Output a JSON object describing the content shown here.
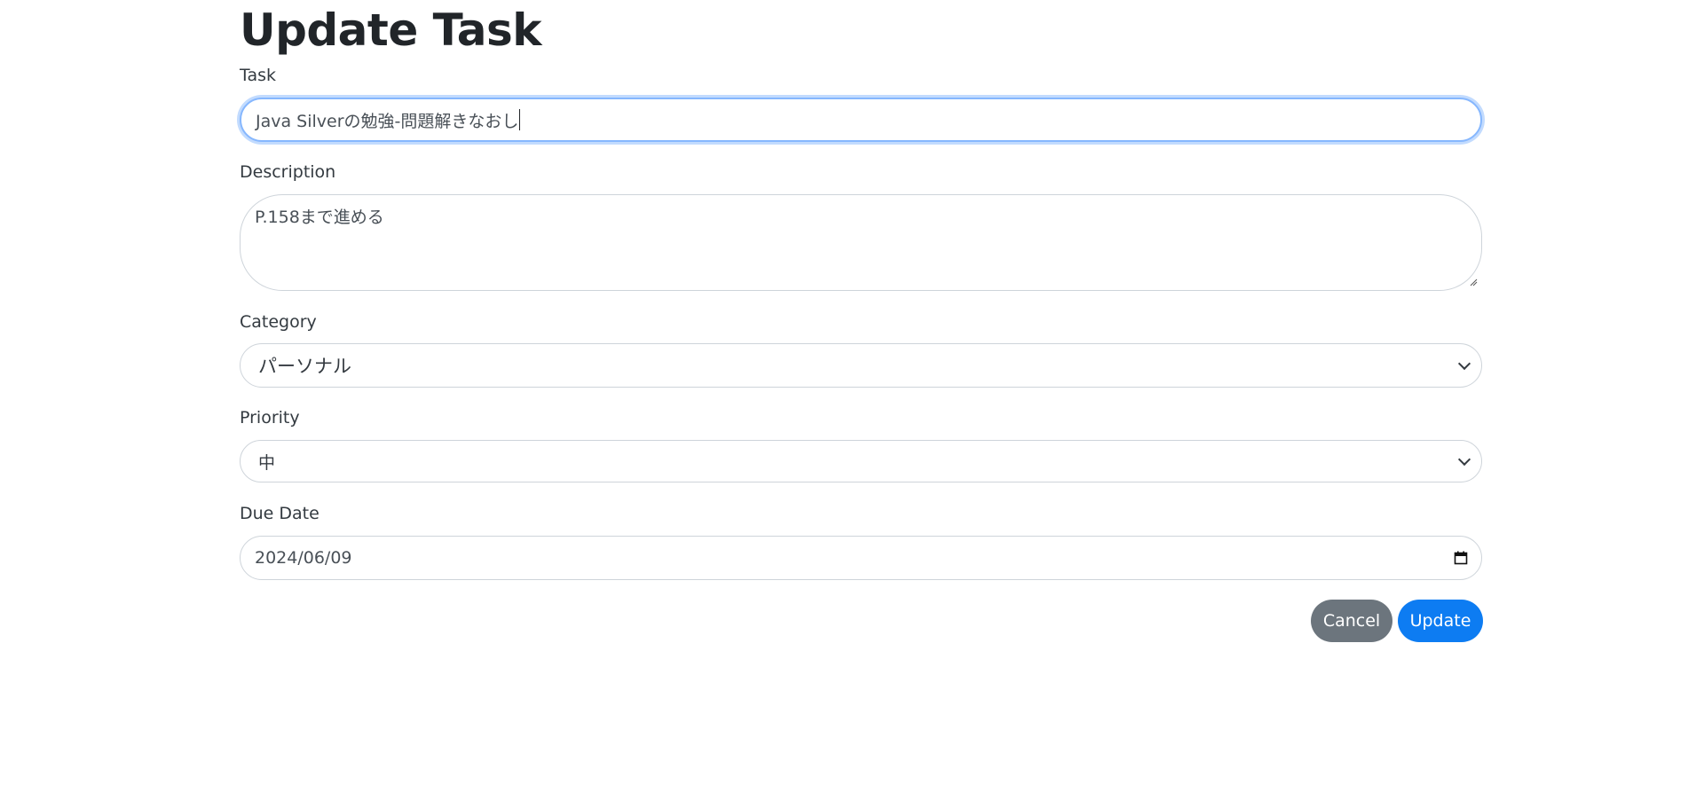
{
  "page": {
    "title": "Update Task"
  },
  "form": {
    "task": {
      "label": "Task",
      "value": "Java Silverの勉強-問題解きなおし"
    },
    "description": {
      "label": "Description",
      "value": "P.158まで進める"
    },
    "category": {
      "label": "Category",
      "selected": "パーソナル"
    },
    "priority": {
      "label": "Priority",
      "selected": "中"
    },
    "due_date": {
      "label": "Due Date",
      "value": "2024/06/09"
    }
  },
  "actions": {
    "cancel_label": "Cancel",
    "update_label": "Update"
  },
  "colors": {
    "primary": "#0d7cf2",
    "secondary": "#6c757d",
    "focus_border": "#86b7fe"
  },
  "icons": {
    "select_arrow": "chevron-down-icon",
    "date_picker": "calendar-icon",
    "textarea_resize": "resize-handle-icon"
  }
}
